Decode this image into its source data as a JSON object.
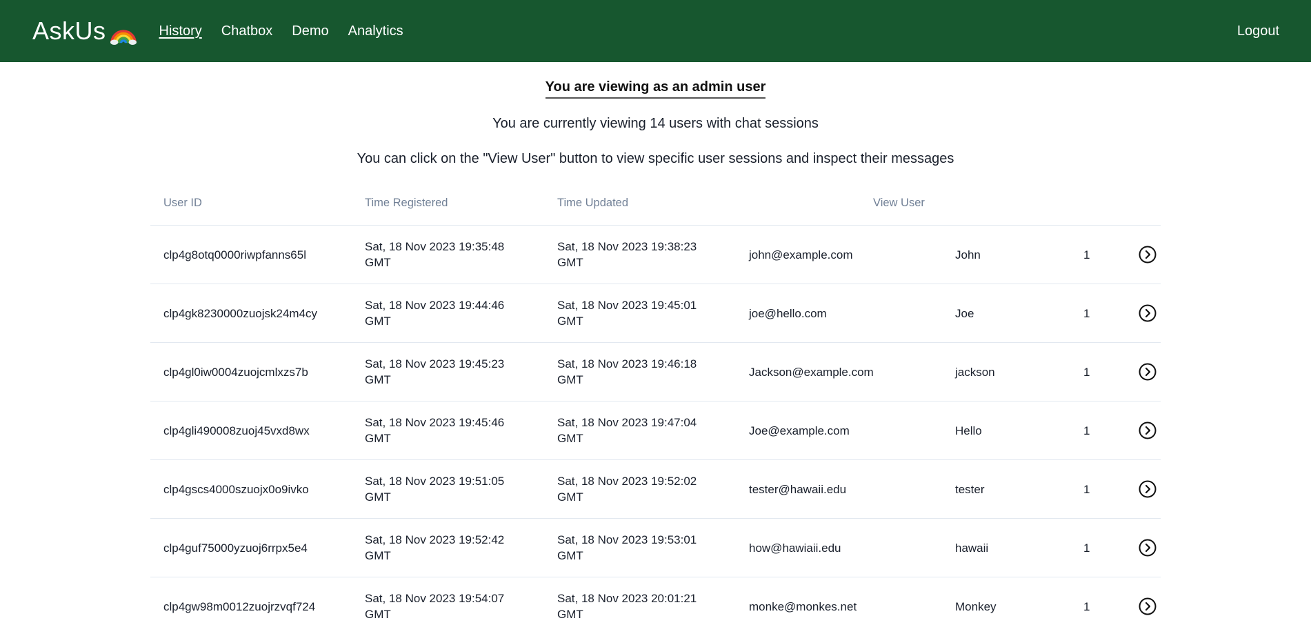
{
  "nav": {
    "brand": "AskUs",
    "links": [
      "History",
      "Chatbox",
      "Demo",
      "Analytics"
    ],
    "logout": "Logout"
  },
  "main": {
    "admin_heading": "You are viewing as an admin user",
    "count_text": "You are currently viewing 14 users with chat sessions",
    "instruction_text": "You can click on the \"View User\" button to view specific user sessions and inspect their messages"
  },
  "table": {
    "headers": {
      "user_id": "User ID",
      "time_registered": "Time Registered",
      "time_updated": "Time Updated",
      "view_user": "View User"
    },
    "rows": [
      {
        "id": "clp4g8otq0000riwpfanns65l",
        "registered": [
          "Sat, 18 Nov 2023 19:35:48",
          "GMT"
        ],
        "updated": [
          "Sat, 18 Nov 2023 19:38:23",
          "GMT"
        ],
        "email": "john@example.com",
        "name": "John",
        "count": "1"
      },
      {
        "id": "clp4gk8230000zuojsk24m4cy",
        "registered": [
          "Sat, 18 Nov 2023 19:44:46",
          "GMT"
        ],
        "updated": [
          "Sat, 18 Nov 2023 19:45:01",
          "GMT"
        ],
        "email": "joe@hello.com",
        "name": "Joe",
        "count": "1"
      },
      {
        "id": "clp4gl0iw0004zuojcmlxzs7b",
        "registered": [
          "Sat, 18 Nov 2023 19:45:23",
          "GMT"
        ],
        "updated": [
          "Sat, 18 Nov 2023 19:46:18",
          "GMT"
        ],
        "email": "Jackson@example.com",
        "name": "jackson",
        "count": "1"
      },
      {
        "id": "clp4gli490008zuoj45vxd8wx",
        "registered": [
          "Sat, 18 Nov 2023 19:45:46",
          "GMT"
        ],
        "updated": [
          "Sat, 18 Nov 2023 19:47:04",
          "GMT"
        ],
        "email": "Joe@example.com",
        "name": "Hello",
        "count": "1"
      },
      {
        "id": "clp4gscs4000szuojx0o9ivko",
        "registered": [
          "Sat, 18 Nov 2023 19:51:05",
          "GMT"
        ],
        "updated": [
          "Sat, 18 Nov 2023 19:52:02",
          "GMT"
        ],
        "email": "tester@hawaii.edu",
        "name": "tester",
        "count": "1"
      },
      {
        "id": "clp4guf75000yzuoj6rrpx5e4",
        "registered": [
          "Sat, 18 Nov 2023 19:52:42",
          "GMT"
        ],
        "updated": [
          "Sat, 18 Nov 2023 19:53:01",
          "GMT"
        ],
        "email": "how@hawiaii.edu",
        "name": "hawaii",
        "count": "1"
      },
      {
        "id": "clp4gw98m0012zuojrzvqf724",
        "registered": [
          "Sat, 18 Nov 2023 19:54:07",
          "GMT"
        ],
        "updated": [
          "Sat, 18 Nov 2023 20:01:21",
          "GMT"
        ],
        "email": "monke@monkes.net",
        "name": "Monkey",
        "count": "1"
      }
    ]
  },
  "icons": {
    "brand_emoji": "rainbow-icon",
    "row_action": "chevron-right-circle-icon"
  },
  "colors": {
    "navbar": "#17572f",
    "header_text": "#718096"
  }
}
